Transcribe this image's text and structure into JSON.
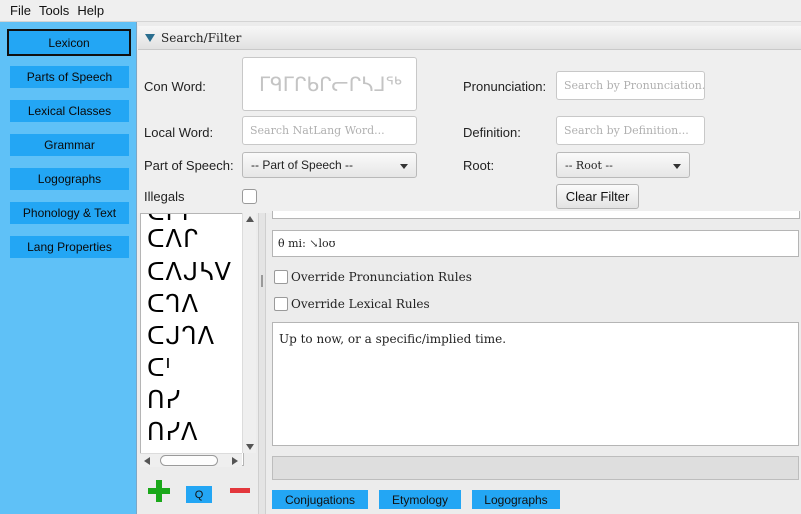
{
  "menu": [
    "File",
    "Tools",
    "Help"
  ],
  "sidebar": {
    "items": [
      {
        "label": "Lexicon"
      },
      {
        "label": "Parts of Speech"
      },
      {
        "label": "Lexical Classes"
      },
      {
        "label": "Grammar"
      },
      {
        "label": "Logographs"
      },
      {
        "label": "Phonology & Text"
      },
      {
        "label": "Lang Properties"
      }
    ]
  },
  "filter": {
    "title": "Search/Filter",
    "con_word_label": "Con Word:",
    "con_word_placeholder": "ᒥᑫᒥᒋᑲᒋᓕᒋᓴᒧᖅ",
    "pronunciation_label": "Pronunciation:",
    "pronunciation_placeholder": "Search by Pronunciation.",
    "local_word_label": "Local Word:",
    "local_word_placeholder": "Search NatLang Word...",
    "definition_label": "Definition:",
    "definition_placeholder": "Search by Definition...",
    "pos_label": "Part of Speech:",
    "pos_value": "-- Part of Speech --",
    "root_label": "Root:",
    "root_value": "-- Root --",
    "illegals_label": "Illegals",
    "clear_button": "Clear Filter"
  },
  "word_list": {
    "items": [
      "ᑕᒋᒥ",
      "ᑕᐱᒋ",
      "ᑕᐱᒍᓴᐯ",
      "ᑕᒉᐱ",
      "ᑕᒍᒉᐱ",
      "ᑕᑊ",
      "ᑎᓯ",
      "ᑎᓯᐱ"
    ]
  },
  "list_buttons": {
    "q": "Q"
  },
  "detail": {
    "pronunciation": "θ mi: ↘loʊ",
    "override_pron": "Override Pronunciation Rules",
    "override_lex": "Override Lexical Rules",
    "definition": "Up to now, or a specific/implied time.",
    "tabs": [
      "Conjugations",
      "Etymology",
      "Logographs"
    ]
  },
  "colors": {
    "sidebar_bg": "#5fc1f7",
    "nav_button": "#23a6f4",
    "add_icon": "#1aa81a",
    "delete_icon": "#e3373c"
  }
}
